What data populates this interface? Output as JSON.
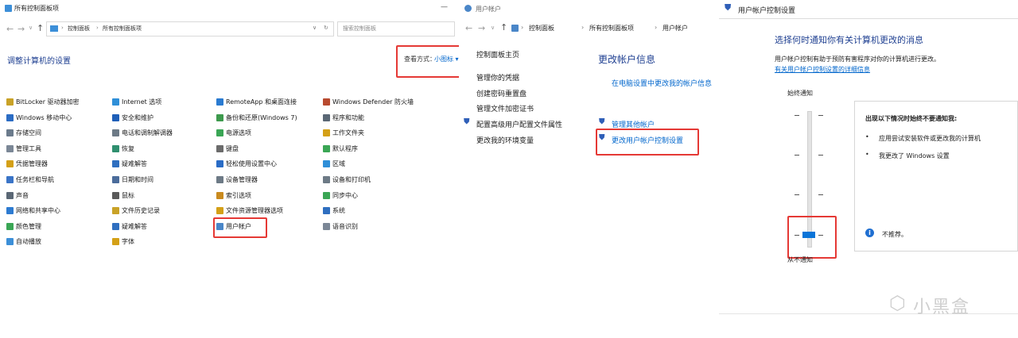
{
  "left": {
    "title": "所有控制面板项",
    "minimize": "—",
    "address": {
      "seg1": "控制面板",
      "seg2": "所有控制面板项"
    },
    "search_placeholder": "搜索控制面板",
    "heading": "调整计算机的设置",
    "view_label": "查看方式：",
    "view_value": "小图标 ▾",
    "items": [
      {
        "label": "BitLocker 驱动器加密",
        "color": "#c9a227"
      },
      {
        "label": "Windows 移动中心",
        "color": "#2b6cc4"
      },
      {
        "label": "存储空间",
        "color": "#6b7b8c"
      },
      {
        "label": "管理工具",
        "color": "#7b8796"
      },
      {
        "label": "凭据管理器",
        "color": "#d4a017"
      },
      {
        "label": "任务栏和导航",
        "color": "#3a74c7"
      },
      {
        "label": "声音",
        "color": "#5a6775"
      },
      {
        "label": "网络和共享中心",
        "color": "#2d7bd1"
      },
      {
        "label": "颜色管理",
        "color": "#3aa655"
      },
      {
        "label": "自动播放",
        "color": "#3c8fd8"
      },
      {
        "label": "Internet 选项",
        "color": "#2f8fd8"
      },
      {
        "label": "安全和维护",
        "color": "#1f5fb8"
      },
      {
        "label": "电话和调制解调器",
        "color": "#6d7a86"
      },
      {
        "label": "恢复",
        "color": "#2f8f6f"
      },
      {
        "label": "疑难解答",
        "color": "#2f6fc0"
      },
      {
        "label": "日期和时间",
        "color": "#4b6c9b"
      },
      {
        "label": "鼠标",
        "color": "#5a5a5a"
      },
      {
        "label": "文件历史记录",
        "color": "#c9a227"
      },
      {
        "label": "疑难解答",
        "color": "#2f6fc0"
      },
      {
        "label": "字体",
        "color": "#d4a017"
      },
      {
        "label": "RemoteApp 和桌面连接",
        "color": "#2a7bd1"
      },
      {
        "label": "备份和还原(Windows 7)",
        "color": "#3d9a4d"
      },
      {
        "label": "电源选项",
        "color": "#3aa655"
      },
      {
        "label": "键盘",
        "color": "#6b6b6b"
      },
      {
        "label": "轻松使用设置中心",
        "color": "#2a6cc6"
      },
      {
        "label": "设备管理器",
        "color": "#6d7a86"
      },
      {
        "label": "索引选项",
        "color": "#c98a1f"
      },
      {
        "label": "文件资源管理器选项",
        "color": "#d4a017"
      },
      {
        "label": "用户帐户",
        "color": "#4a86c8"
      },
      {
        "label": "Windows Defender 防火墙",
        "color": "#b84a2f"
      },
      {
        "label": "程序和功能",
        "color": "#5a6775"
      },
      {
        "label": "工作文件夹",
        "color": "#d4a017"
      },
      {
        "label": "默认程序",
        "color": "#3aa655"
      },
      {
        "label": "区域",
        "color": "#2f8fd8"
      },
      {
        "label": "设备和打印机",
        "color": "#6d7a86"
      },
      {
        "label": "同步中心",
        "color": "#3aa655"
      },
      {
        "label": "系统",
        "color": "#2f6fc0"
      },
      {
        "label": "语音识别",
        "color": "#7b8796"
      }
    ]
  },
  "middle": {
    "title": "用户帐户",
    "address": {
      "seg1": "控制面板",
      "seg2": "所有控制面板项",
      "seg3": "用户帐户"
    },
    "sidebar": [
      "控制面板主页",
      "管理你的凭据",
      "创建密码重置盘",
      "管理文件加密证书",
      "配置高级用户配置文件属性",
      "更改我的环境变量"
    ],
    "main_heading": "更改帐户信息",
    "pc_settings_link": "在电脑设置中更改我的帐户信息",
    "manage_other": "管理其他帐户",
    "change_uac": "更改用户帐户控制设置"
  },
  "right": {
    "title": "用户帐户控制设置",
    "heading": "选择何时通知你有关计算机更改的消息",
    "description": "用户帐户控制有助于预防有害程序对你的计算机进行更改。",
    "more_link": "有关用户帐户控制设置的详细信息",
    "top_label": "始终通知",
    "bottom_label": "从不通知",
    "info_title": "出现以下情况时始终不要通知我:",
    "bullets": [
      "应用尝试安装软件或更改我的计算机",
      "我更改了 Windows 设置"
    ],
    "note": "不推荐。",
    "slider_level": "4 of 4 (never notify)",
    "watermark": "小黑盒"
  }
}
